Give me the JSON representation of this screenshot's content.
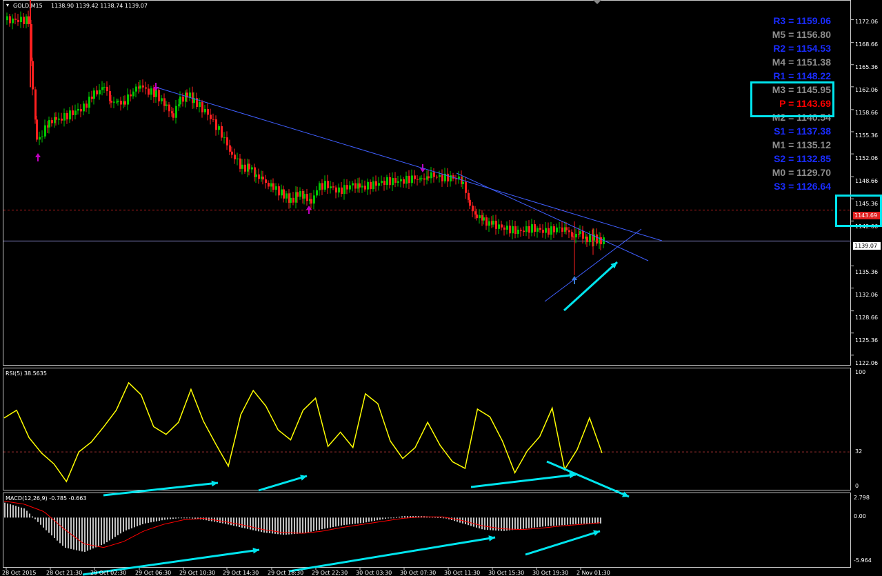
{
  "header": {
    "symbol": "GOLD,M15",
    "ohlc": "1138.90 1139.42 1138.74 1139.07"
  },
  "colors": {
    "background": "#000000",
    "frame": "#c8c8c8",
    "bull": "#00c800",
    "bear": "#ff2020",
    "trendline": "#3f5fff",
    "highlight": "#00e5ee",
    "rsi": "#ffff00",
    "macd_signal": "#ff0000",
    "macd_hist": "#c0c0c0",
    "pivot_blue": "#1a2cff",
    "pivot_gray": "#8c8c8c",
    "pivot_red": "#ff0000",
    "fractal": "#c000c0"
  },
  "price_axis": [
    "1172.06",
    "1168.66",
    "1165.36",
    "1162.06",
    "1158.66",
    "1155.36",
    "1152.06",
    "1148.66",
    "1145.36",
    "1142.06",
    "1135.36",
    "1132.06",
    "1128.66",
    "1125.36",
    "1122.06"
  ],
  "price_tags": {
    "pivot": "1143.69",
    "current": "1139.07"
  },
  "pivots": [
    {
      "text": "R3 = 1159.06",
      "kind": "blue"
    },
    {
      "text": "M5 = 1156.80",
      "kind": "gray"
    },
    {
      "text": "R2 = 1154.53",
      "kind": "blue"
    },
    {
      "text": "M4 = 1151.38",
      "kind": "gray"
    },
    {
      "text": "R1 = 1148.22",
      "kind": "blue"
    },
    {
      "text": "M3 = 1145.95",
      "kind": "gray"
    },
    {
      "text": "P  = 1143.69",
      "kind": "red"
    },
    {
      "text": "M2 = 1140.54",
      "kind": "gray"
    },
    {
      "text": "S1 = 1137.38",
      "kind": "blue"
    },
    {
      "text": "M1 = 1135.12",
      "kind": "gray"
    },
    {
      "text": "S2 = 1132.85",
      "kind": "blue"
    },
    {
      "text": "M0 = 1129.70",
      "kind": "gray"
    },
    {
      "text": "S3 = 1126.64",
      "kind": "blue"
    }
  ],
  "rsi": {
    "label": "RSI(5) 38.5635",
    "axis": [
      "100",
      "32",
      "0"
    ]
  },
  "macd": {
    "label": "MACD(12,26,9) -0.785 -0.663",
    "axis": [
      "2.798",
      "0.00",
      "-5.964"
    ]
  },
  "time_axis": [
    "28 Oct 2015",
    "28 Oct 21:30",
    "29 Oct 02:30",
    "29 Oct 06:30",
    "29 Oct 10:30",
    "29 Oct 14:30",
    "29 Oct 18:30",
    "29 Oct 22:30",
    "30 Oct 03:30",
    "30 Oct 07:30",
    "30 Oct 11:30",
    "30 Oct 15:30",
    "30 Oct 19:30",
    "2 Nov 01:30"
  ],
  "chart_data": [
    {
      "type": "candlestick",
      "title": "GOLD,M15",
      "y_range": [
        1120.5,
        1175.0
      ],
      "close_approx": {
        "x": [
          "28 Oct 2015",
          "28 Oct 21:30",
          "29 Oct 02:30",
          "29 Oct 06:30",
          "29 Oct 10:30",
          "29 Oct 14:30",
          "29 Oct 18:30",
          "29 Oct 22:30",
          "30 Oct 03:30",
          "30 Oct 07:30",
          "30 Oct 11:30",
          "30 Oct 15:30",
          "30 Oct 19:30",
          "2 Nov 01:30"
        ],
        "y": [
          1172.0,
          1157.5,
          1161.5,
          1162.5,
          1160.0,
          1152.5,
          1146.5,
          1147.5,
          1147.5,
          1149.5,
          1143.0,
          1141.0,
          1140.5,
          1139.07
        ]
      },
      "horizontal_lines": [
        1143.69,
        1139.07
      ],
      "grid": false
    },
    {
      "type": "line",
      "title": "RSI(5) 38.5635",
      "y_range": [
        0,
        100
      ],
      "levels": [
        32
      ],
      "series": [
        {
          "name": "RSI(5)",
          "values": [
            63,
            70,
            45,
            31,
            21,
            5,
            32,
            41,
            55,
            70,
            95,
            84,
            55,
            48,
            59,
            89,
            60,
            39,
            19,
            66,
            88,
            74,
            52,
            43,
            70,
            81,
            37,
            50,
            36,
            85,
            76,
            42,
            26,
            36,
            59,
            38,
            23,
            17,
            71,
            64,
            42,
            13,
            33,
            46,
            72,
            16,
            34,
            63,
            31
          ]
        }
      ]
    },
    {
      "type": "bar",
      "title": "MACD(12,26,9) -0.785 -0.663",
      "y_range": [
        -5.964,
        2.798
      ],
      "series": [
        {
          "name": "MACD",
          "values": [
            2.0,
            1.2,
            -1.5,
            -4.0,
            -4.6,
            -3.5,
            -1.8,
            -0.8,
            -0.3,
            0.0,
            -0.3,
            -0.8,
            -1.4,
            -2.0,
            -2.3,
            -2.1,
            -1.5,
            -1.0,
            -0.7,
            -0.2,
            0.2,
            0.2,
            0.0,
            -0.8,
            -1.6,
            -1.8,
            -1.5,
            -1.2,
            -1.0,
            -0.8,
            -0.785
          ]
        },
        {
          "name": "Signal",
          "values": [
            2.2,
            1.8,
            0.8,
            -1.5,
            -3.5,
            -4.0,
            -3.2,
            -1.8,
            -0.9,
            -0.3,
            -0.1,
            -0.5,
            -1.0,
            -1.6,
            -2.0,
            -2.1,
            -1.8,
            -1.3,
            -0.9,
            -0.5,
            -0.1,
            0.1,
            0.1,
            -0.4,
            -1.1,
            -1.5,
            -1.6,
            -1.4,
            -1.1,
            -0.9,
            -0.663
          ]
        }
      ]
    }
  ]
}
